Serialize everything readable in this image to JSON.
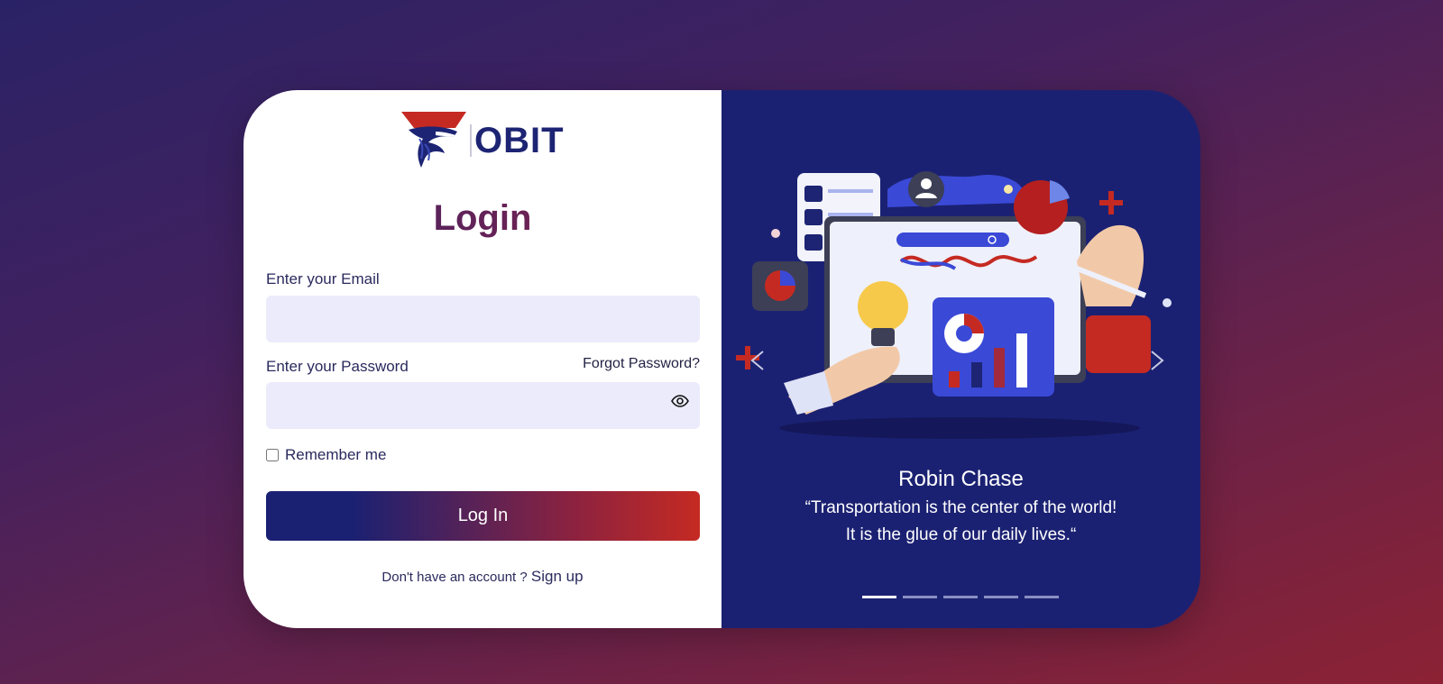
{
  "brand": {
    "name": "OBIT"
  },
  "form": {
    "title": "Login",
    "email_label": "Enter your Email",
    "email_value": "",
    "email_placeholder": "",
    "password_label": "Enter your Password",
    "password_value": "",
    "password_placeholder": "",
    "forgot_label": "Forgot Password?",
    "remember_label": "Remember me",
    "remember_checked": false,
    "submit_label": "Log In",
    "signup_prompt": "Don't have an account ?",
    "signup_link": "Sign up"
  },
  "carousel": {
    "author": "Robin Chase",
    "quote_line1": "“Transportation is the center of the world!",
    "quote_line2": "It is the glue of our daily lives.“",
    "slide_count": 5,
    "active_slide": 1
  },
  "colors": {
    "navy": "#1b2172",
    "red": "#c52a22",
    "input_bg": "#ecebfb"
  },
  "icons": {
    "eye": "eye-icon",
    "prev": "chevron-left-icon",
    "next": "chevron-right-icon"
  }
}
